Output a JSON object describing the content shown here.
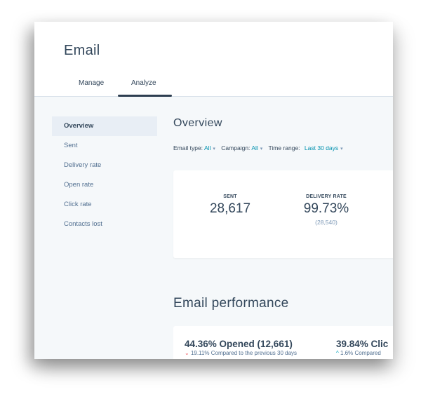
{
  "app": {
    "title": "Email"
  },
  "tabs": [
    {
      "label": "Manage",
      "active": false
    },
    {
      "label": "Analyze",
      "active": true
    }
  ],
  "sidebar": {
    "items": [
      {
        "label": "Overview",
        "active": true
      },
      {
        "label": "Sent",
        "active": false
      },
      {
        "label": "Delivery rate",
        "active": false
      },
      {
        "label": "Open rate",
        "active": false
      },
      {
        "label": "Click rate",
        "active": false
      },
      {
        "label": "Contacts lost",
        "active": false
      }
    ]
  },
  "overview": {
    "title": "Overview",
    "filters": {
      "email_type_label": "Email type:",
      "email_type_value": "All",
      "campaign_label": "Campaign:",
      "campaign_value": "All",
      "time_range_label": "Time range:",
      "time_range_value": "Last 30 days",
      "caret_icon": "▾"
    },
    "stats": {
      "sent": {
        "label": "SENT",
        "value": "28,617"
      },
      "delivery_rate": {
        "label": "DELIVERY RATE",
        "value": "99.73%",
        "sub": "(28,540)"
      }
    }
  },
  "performance": {
    "title": "Email performance",
    "items": [
      {
        "headline": "44.36% Opened (12,661)",
        "trend": "down",
        "trend_icon": "⌄",
        "change": "19.11%",
        "compare_text": "Compared to the previous 30 days"
      },
      {
        "headline": "39.84% Clic",
        "trend": "up",
        "trend_icon": "^",
        "change": "1.6%",
        "compare_text": "Compared"
      }
    ]
  },
  "colors": {
    "accent": "#0091ae",
    "text": "#33475b",
    "negative": "#f2545b",
    "positive": "#00a4bd"
  }
}
